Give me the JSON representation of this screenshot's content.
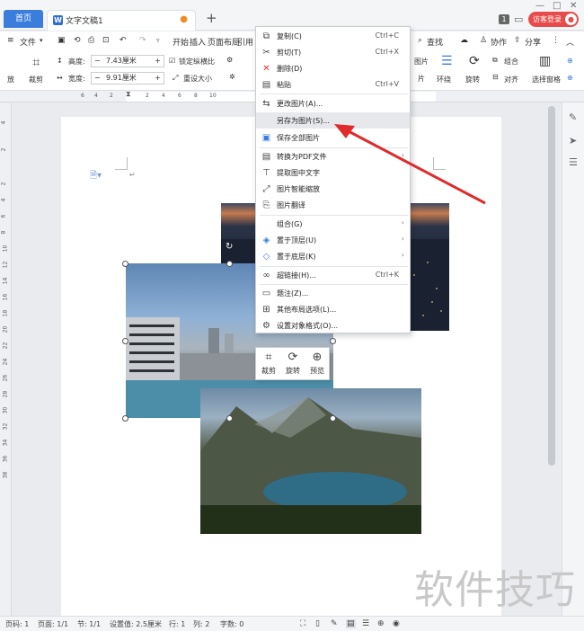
{
  "tabs": {
    "home": "首页",
    "doc": "文字文稿1",
    "new_tab": "+",
    "badge": "1",
    "visitor_login": "访客登录"
  },
  "window": {
    "min": "—",
    "max": "□",
    "close": "✕"
  },
  "menubar": {
    "file": "文件",
    "start": "开始",
    "insert": "插入",
    "layout": "页面布局",
    "reference": "引用",
    "search": "查找",
    "collab": "协作",
    "share": "分享"
  },
  "ribbon": {
    "put": "放",
    "crop": "裁剪",
    "height_label": "高度:",
    "height_value": "7.43厘米",
    "width_label": "宽度:",
    "width_value": "9.91厘米",
    "lock_ratio": "锁定纵横比",
    "reset_size": "重设大小",
    "image": "图片",
    "picture": "片",
    "wrap": "环绕",
    "rotate": "旋转",
    "group": "组合",
    "align": "对齐",
    "select_pane": "选择窗格"
  },
  "ruler": {
    "ticks": [
      "6",
      "4",
      "2",
      "2",
      "4",
      "6",
      "8",
      "10"
    ],
    "vticks": [
      "4",
      "2",
      "2",
      "4",
      "6",
      "8",
      "10",
      "12",
      "14",
      "16",
      "18",
      "20",
      "22",
      "24",
      "26",
      "28",
      "30",
      "32",
      "34",
      "36",
      "38"
    ]
  },
  "context_menu": {
    "items": [
      {
        "label": "复制(C)",
        "shortcut": "Ctrl+C",
        "icon": "copy-icon",
        "glyph": "⧉"
      },
      {
        "label": "剪切(T)",
        "shortcut": "Ctrl+X",
        "icon": "cut-icon",
        "glyph": "✂"
      },
      {
        "label": "删除(D)",
        "shortcut": "",
        "icon": "delete-icon",
        "glyph": "✕"
      },
      {
        "label": "粘贴",
        "shortcut": "Ctrl+V",
        "icon": "paste-icon",
        "glyph": "📋"
      },
      {
        "label": "更改图片(A)...",
        "shortcut": "",
        "icon": "change-image-icon",
        "glyph": "⇆"
      },
      {
        "label": "另存为图片(S)...",
        "shortcut": "",
        "icon": "",
        "glyph": ""
      },
      {
        "label": "保存全部图片",
        "shortcut": "",
        "icon": "save-all-images-icon",
        "glyph": "▣"
      },
      {
        "label": "转换为PDF文件",
        "shortcut": "",
        "icon": "pdf-icon",
        "glyph": "▤"
      },
      {
        "label": "提取图中文字",
        "shortcut": "",
        "icon": "extract-text-icon",
        "glyph": "T"
      },
      {
        "label": "图片智能缩放",
        "shortcut": "",
        "icon": "smart-scale-icon",
        "glyph": "⤢"
      },
      {
        "label": "图片翻译",
        "shortcut": "",
        "icon": "translate-icon",
        "glyph": "⎘"
      },
      {
        "label": "组合(G)",
        "shortcut": "",
        "icon": "",
        "glyph": ""
      },
      {
        "label": "置于顶层(U)",
        "shortcut": "",
        "icon": "bring-front-icon",
        "glyph": "◈"
      },
      {
        "label": "置于底层(K)",
        "shortcut": "",
        "icon": "send-back-icon",
        "glyph": "◇"
      },
      {
        "label": "超链接(H)...",
        "shortcut": "Ctrl+K",
        "icon": "link-icon",
        "glyph": "∞"
      },
      {
        "label": "题注(Z)...",
        "shortcut": "",
        "icon": "caption-icon",
        "glyph": "▭"
      },
      {
        "label": "其他布局选项(L)...",
        "shortcut": "",
        "icon": "layout-options-icon",
        "glyph": "⊞"
      },
      {
        "label": "设置对象格式(O)...",
        "shortcut": "",
        "icon": "format-object-icon",
        "glyph": "⚙"
      }
    ]
  },
  "float_toolbar": {
    "crop": "裁剪",
    "rotate": "旋转",
    "preview": "预览"
  },
  "statusbar": {
    "page_num": "页码: 1",
    "pages": "页面: 1/1",
    "section": "节: 1/1",
    "setting": "设置值: 2.5厘米",
    "row": "行: 1",
    "col": "列: 2",
    "words": "字数: 0"
  },
  "watermark": "软件技巧",
  "colors": {
    "accent": "#3b7ddc",
    "visitor": "#e84b4b",
    "arrow": "#e02b2b"
  }
}
